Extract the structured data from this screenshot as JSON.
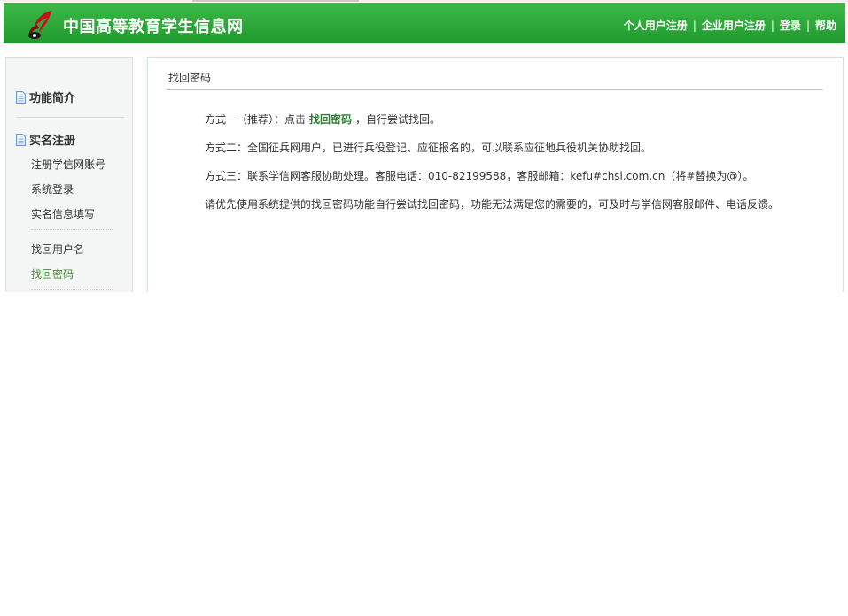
{
  "header": {
    "site_title": "中国高等教育学生信息网",
    "nav": {
      "register_personal": "个人用户注册",
      "register_company": "企业用户注册",
      "login": "登录",
      "help": "帮助",
      "separator": "|"
    },
    "logo_icon": "chsi-bird-logo",
    "bg_color": "#2aa336"
  },
  "sidebar": {
    "sections": [
      {
        "label": "功能简介",
        "icon": "document-icon"
      },
      {
        "label": "实名注册",
        "icon": "document-icon"
      }
    ],
    "items": [
      {
        "label": "注册学信网账号"
      },
      {
        "label": "系统登录"
      },
      {
        "label": "实名信息填写"
      },
      {
        "label": "找回用户名"
      },
      {
        "label": "找回密码",
        "active": true
      }
    ],
    "active_color": "#4a8c3a"
  },
  "main": {
    "breadcrumb": "找回密码",
    "method1": {
      "prefix": "方式一（推荐）：点击",
      "link": "找回密码",
      "suffix": "，自行尝试找回。"
    },
    "method2": "方式二：全国征兵网用户，已进行兵役登记、应征报名的，可以联系应征地兵役机关协助找回。",
    "method3": "方式三：联系学信网客服协助处理。客服电话：010-82199588，客服邮箱：kefu#chsi.com.cn（将#替换为@）。",
    "note": "请优先使用系统提供的找回密码功能自行尝试找回密码，功能无法满足您的需要的，可及时与学信网客服邮件、电话反馈。",
    "link_color": "#2e7d32"
  }
}
